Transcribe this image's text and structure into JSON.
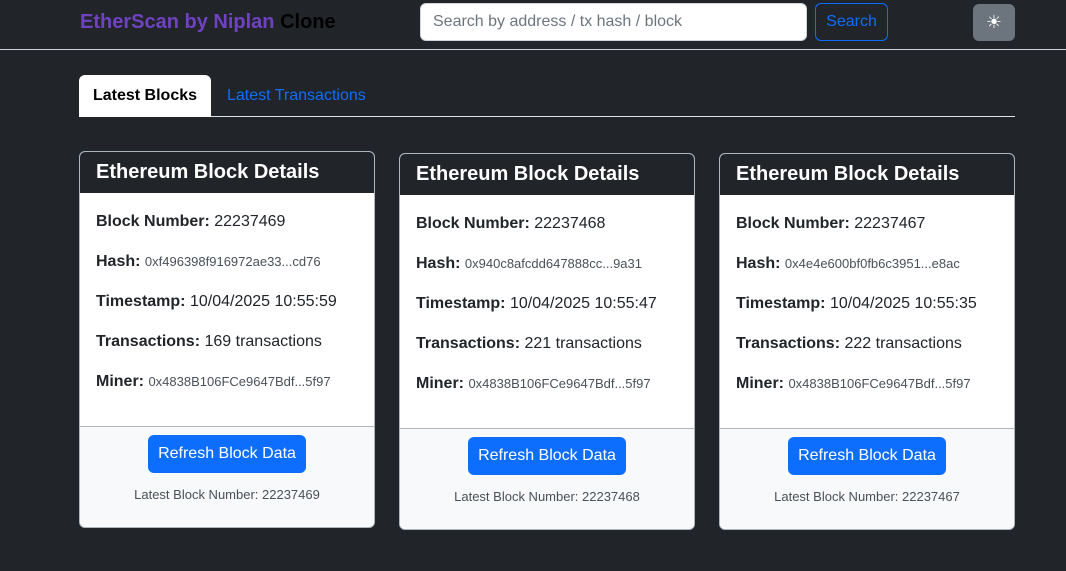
{
  "navbar": {
    "brand_part1": "EtherScan by Niplan",
    "brand_part2": "Clone",
    "search_placeholder": "Search by address / tx hash / block",
    "search_label": "Search",
    "theme_toggle_glyph": "☀"
  },
  "tabs": [
    {
      "label": "Latest Blocks",
      "active": true
    },
    {
      "label": "Latest Transactions",
      "active": false
    }
  ],
  "cards": [
    {
      "title": "Ethereum Block Details",
      "block_number_label": "Block Number:",
      "block_number": "22237469",
      "hash_label": "Hash:",
      "hash": "0xf496398f916972ae33...cd76",
      "timestamp_label": "Timestamp:",
      "timestamp": "10/04/2025 10:55:59",
      "transactions_label": "Transactions:",
      "transactions": "169 transactions",
      "miner_label": "Miner:",
      "miner": "0x4838B106FCe9647Bdf...5f97",
      "refresh_label": "Refresh Block Data",
      "latest_block_text": "Latest Block Number: 22237469"
    },
    {
      "title": "Ethereum Block Details",
      "block_number_label": "Block Number:",
      "block_number": "22237468",
      "hash_label": "Hash:",
      "hash": "0x940c8afcdd647888cc...9a31",
      "timestamp_label": "Timestamp:",
      "timestamp": "10/04/2025 10:55:47",
      "transactions_label": "Transactions:",
      "transactions": "221 transactions",
      "miner_label": "Miner:",
      "miner": "0x4838B106FCe9647Bdf...5f97",
      "refresh_label": "Refresh Block Data",
      "latest_block_text": "Latest Block Number: 22237468"
    },
    {
      "title": "Ethereum Block Details",
      "block_number_label": "Block Number:",
      "block_number": "22237467",
      "hash_label": "Hash:",
      "hash": "0x4e4e600bf0fb6c3951...e8ac",
      "timestamp_label": "Timestamp:",
      "timestamp": "10/04/2025 10:55:35",
      "transactions_label": "Transactions:",
      "transactions": "222 transactions",
      "miner_label": "Miner:",
      "miner": "0x4838B106FCe9647Bdf...5f97",
      "refresh_label": "Refresh Block Data",
      "latest_block_text": "Latest Block Number: 22237467"
    }
  ],
  "colors": {
    "page_background": "#212529",
    "brand_accent": "#6f42c1",
    "primary": "#0d6efd",
    "theme_toggle": "#6c757d"
  }
}
